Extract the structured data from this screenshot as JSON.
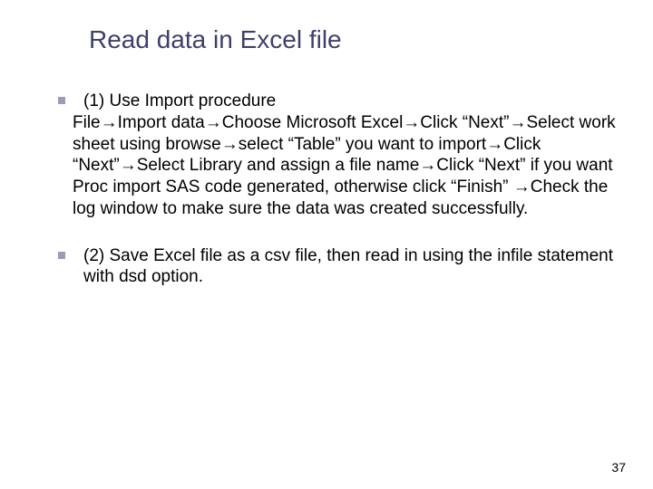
{
  "title": "Read data in Excel file",
  "bullets": [
    {
      "lead": "(1) Use Import procedure",
      "cont": "File→Import data→Choose Microsoft Excel→Click “Next”→Select work sheet using browse→select “Table” you want to import→Click “Next”→Select Library and assign a file name→Click “Next” if you want Proc import SAS code generated, otherwise click “Finish” →Check the log window to make sure the data was created successfully."
    },
    {
      "lead": "(2) Save Excel file as a csv file, then read in using the infile statement with dsd option.",
      "cont": ""
    }
  ],
  "page_number": "37"
}
